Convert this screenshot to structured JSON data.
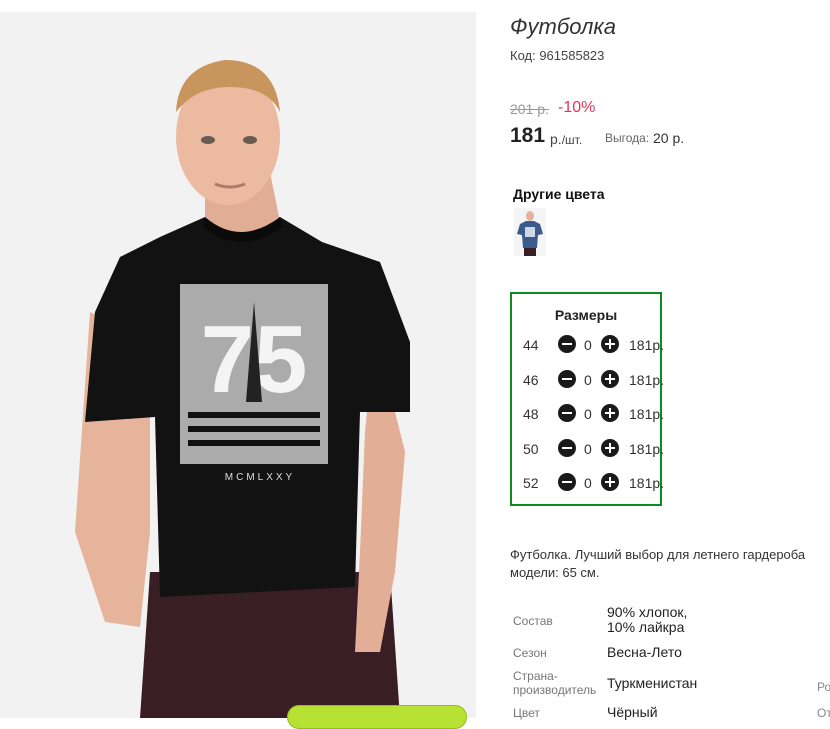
{
  "product": {
    "title": "Футболка",
    "code": "Код: 961585823",
    "old_price": "201 р.",
    "discount": "-10%",
    "price": "181",
    "price_unit_rub": "р.",
    "price_unit_per": "/шт.",
    "saving_label": "Выгода:",
    "saving_value": "20 р."
  },
  "other_colors": {
    "title": "Другие цвета",
    "swatch_color": "#3b5b8f"
  },
  "sizes": {
    "title": "Размеры",
    "rows": [
      {
        "size": "44",
        "qty": "0",
        "price": "181р."
      },
      {
        "size": "46",
        "qty": "0",
        "price": "181р."
      },
      {
        "size": "48",
        "qty": "0",
        "price": "181р."
      },
      {
        "size": "50",
        "qty": "0",
        "price": "181р."
      },
      {
        "size": "52",
        "qty": "0",
        "price": "181р."
      }
    ],
    "border_color": "#0f8a1e"
  },
  "description": {
    "line1": "Футболка. Лучший выбор для летнего гардероба",
    "line2": "модели: 65 см."
  },
  "attributes": [
    {
      "label": "Состав",
      "value_line1": "90% хлопок,",
      "value_line2": "10% лайкра"
    },
    {
      "label": "Сезон",
      "value_line1": "Весна-Лето"
    },
    {
      "label_line1": "Страна-",
      "label_line2": "производитель",
      "value_line1": "Туркменистан"
    },
    {
      "label": "Цвет",
      "value_line1": "Чёрный"
    }
  ],
  "edge_text": {
    "top": "Ро",
    "bottom": "От"
  },
  "photo": {
    "tshirt_print_number": "75",
    "tshirt_print_text": "MCMLXXY"
  },
  "colors": {
    "discount": "#e8325a",
    "add_button": "#b7e234"
  }
}
